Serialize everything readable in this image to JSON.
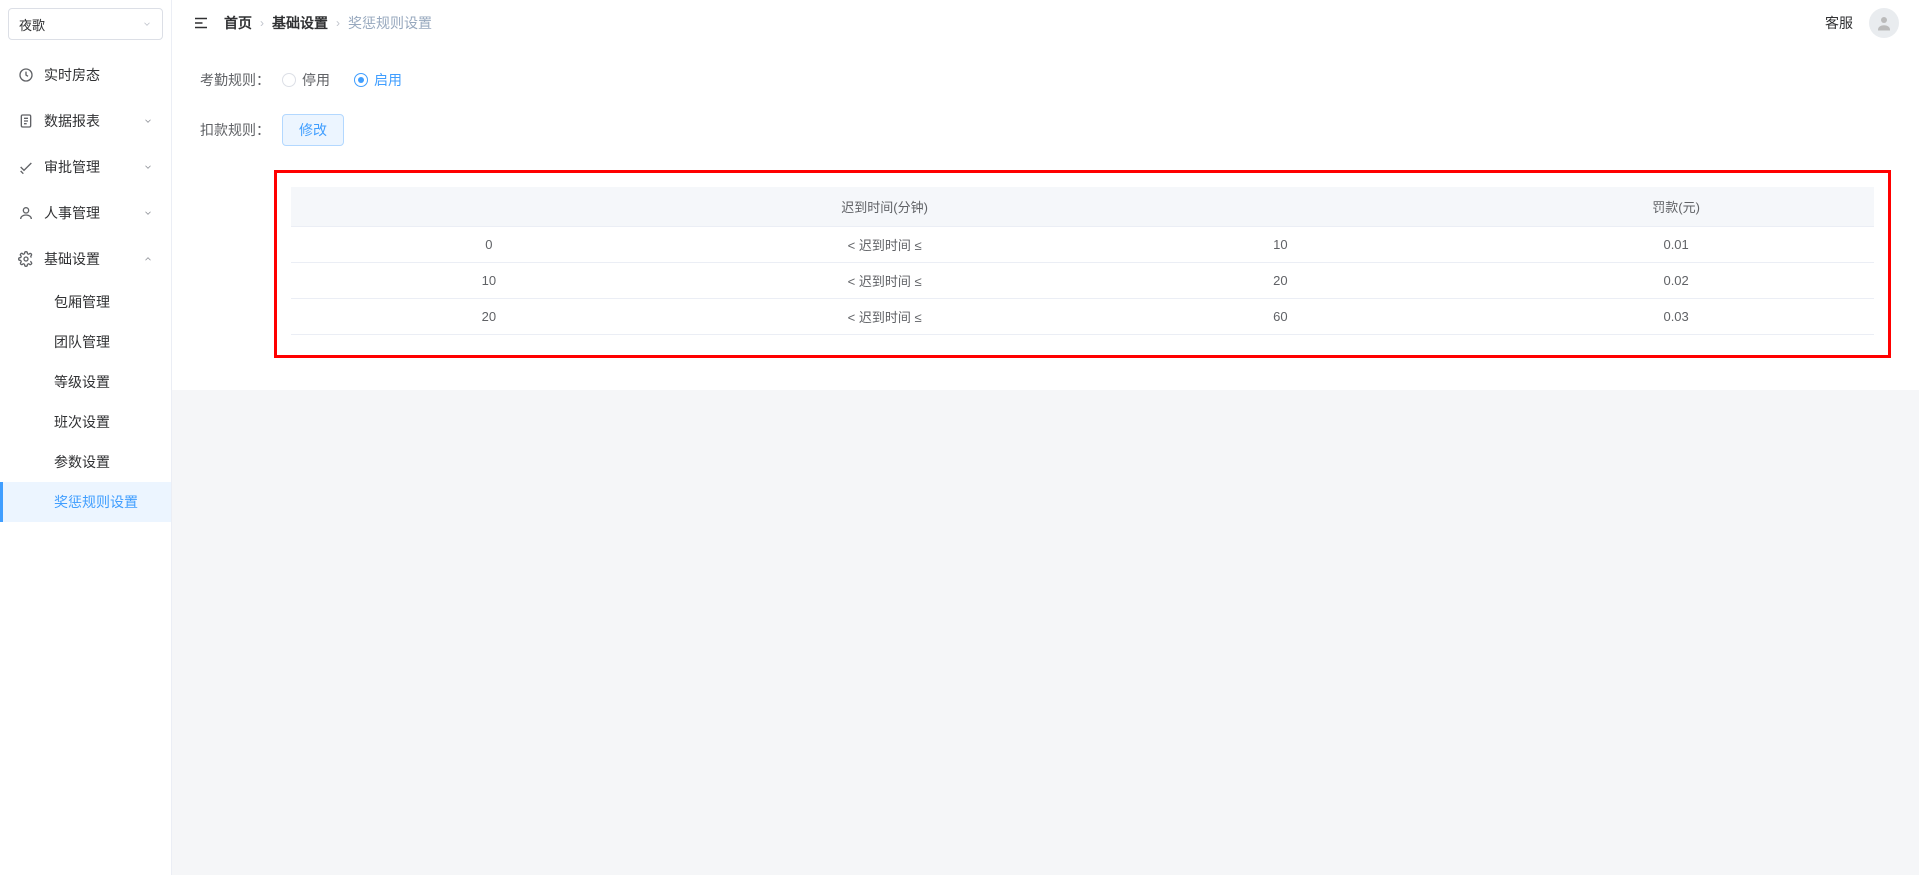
{
  "tenant": {
    "name": "夜歌"
  },
  "nav": {
    "items": [
      {
        "label": "实时房态"
      },
      {
        "label": "数据报表"
      },
      {
        "label": "审批管理"
      },
      {
        "label": "人事管理"
      },
      {
        "label": "基础设置"
      }
    ],
    "basic_children": [
      {
        "label": "包厢管理"
      },
      {
        "label": "团队管理"
      },
      {
        "label": "等级设置"
      },
      {
        "label": "班次设置"
      },
      {
        "label": "参数设置"
      },
      {
        "label": "奖惩规则设置"
      }
    ]
  },
  "breadcrumb": {
    "home": "首页",
    "parent": "基础设置",
    "current": "奖惩规则设置"
  },
  "topbar": {
    "service": "客服"
  },
  "form": {
    "attendance_label": "考勤规则：",
    "radio_disable": "停用",
    "radio_enable": "启用",
    "deduction_label": "扣款规则：",
    "modify_btn": "修改"
  },
  "table": {
    "h1": "迟到时间(分钟)",
    "h2": "罚款(元)",
    "range_label": "< 迟到时间 ≤",
    "rows": [
      {
        "from": "0",
        "to": "10",
        "fine": "0.01"
      },
      {
        "from": "10",
        "to": "20",
        "fine": "0.02"
      },
      {
        "from": "20",
        "to": "60",
        "fine": "0.03"
      }
    ]
  }
}
